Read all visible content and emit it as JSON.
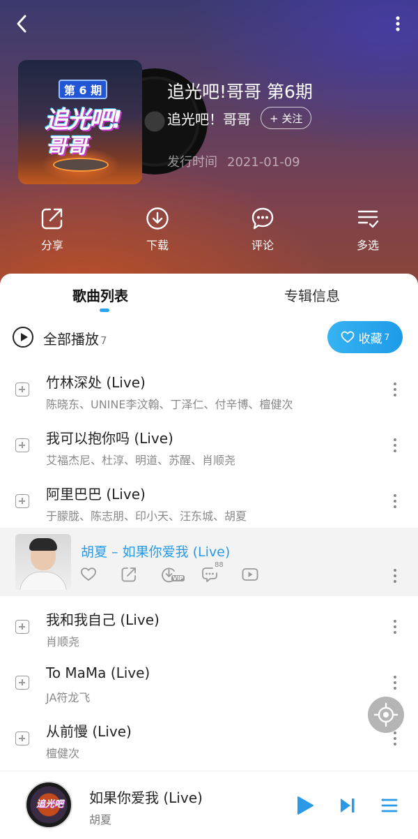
{
  "header": {
    "back_icon": "back-icon",
    "more_icon": "more-vertical-icon"
  },
  "album": {
    "cover_episode": "第 6 期",
    "cover_brand_line1": "追光吧!",
    "cover_brand_line2": "哥哥",
    "title": "追光吧!哥哥 第6期",
    "artist": "追光吧！哥哥",
    "follow_label": "+ 关注",
    "release_label": "发行时间",
    "release_date": "2021-01-09"
  },
  "actions": [
    {
      "label": "分享",
      "icon": "share-icon"
    },
    {
      "label": "下载",
      "icon": "download-icon"
    },
    {
      "label": "评论",
      "icon": "comment-icon"
    },
    {
      "label": "多选",
      "icon": "multi-select-icon"
    }
  ],
  "tabs": {
    "active": "歌曲列表",
    "inactive": "专辑信息"
  },
  "play_all": {
    "label": "全部播放",
    "count": "7",
    "collect_label": "收藏",
    "collect_count": "7"
  },
  "songs": [
    {
      "title": "竹林深处 (Live)",
      "artists": "陈晓东、UNINE李汶翰、丁泽仁、付辛博、檀健次"
    },
    {
      "title": "我可以抱你吗 (Live)",
      "artists": "艾福杰尼、杜淳、明道、苏醒、肖顺尧"
    },
    {
      "title": "阿里巴巴 (Live)",
      "artists": "于朦胧、陈志朋、印小天、汪东城、胡夏"
    },
    {
      "title": "我和我自己 (Live)",
      "artists": "肖顺尧"
    },
    {
      "title": "To MaMa (Live)",
      "artists": "JA符龙飞"
    },
    {
      "title": "从前慢 (Live)",
      "artists": "檀健次"
    }
  ],
  "now_playing": {
    "title": "胡夏 – 如果你爱我 (Live)",
    "comment_count": "88",
    "vip_badge": "VIP"
  },
  "player": {
    "title": "如果你爱我 (Live)",
    "artist": "胡夏",
    "disc_text": "追光吧"
  },
  "colors": {
    "accent": "#2a9ae6",
    "collect_button": "#1e9be8"
  }
}
